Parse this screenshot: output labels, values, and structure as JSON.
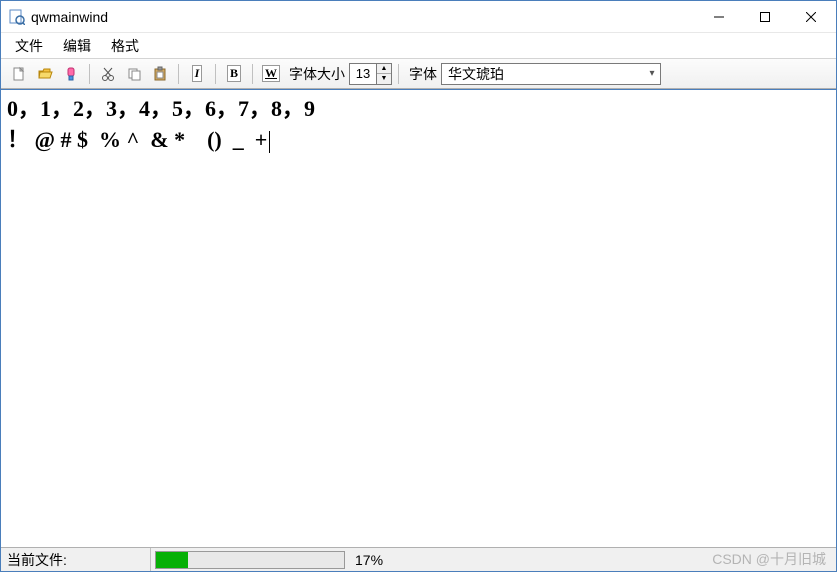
{
  "window": {
    "title": "qwmainwind"
  },
  "menubar": {
    "items": [
      "文件",
      "编辑",
      "格式"
    ]
  },
  "toolbar": {
    "font_size_label": "字体大小",
    "font_size_value": "13",
    "font_label": "字体",
    "font_value": "华文琥珀",
    "italic": "I",
    "bold": "B",
    "underline": "W"
  },
  "editor": {
    "line1": "0，1，2，3，4，5，6，7，8，9",
    "line2": "！ @ # $  % ^  & *    ()  _  +"
  },
  "statusbar": {
    "current_file_label": "当前文件:",
    "progress_percent": 17,
    "progress_text": "17%"
  },
  "watermark": "CSDN @十月旧城"
}
